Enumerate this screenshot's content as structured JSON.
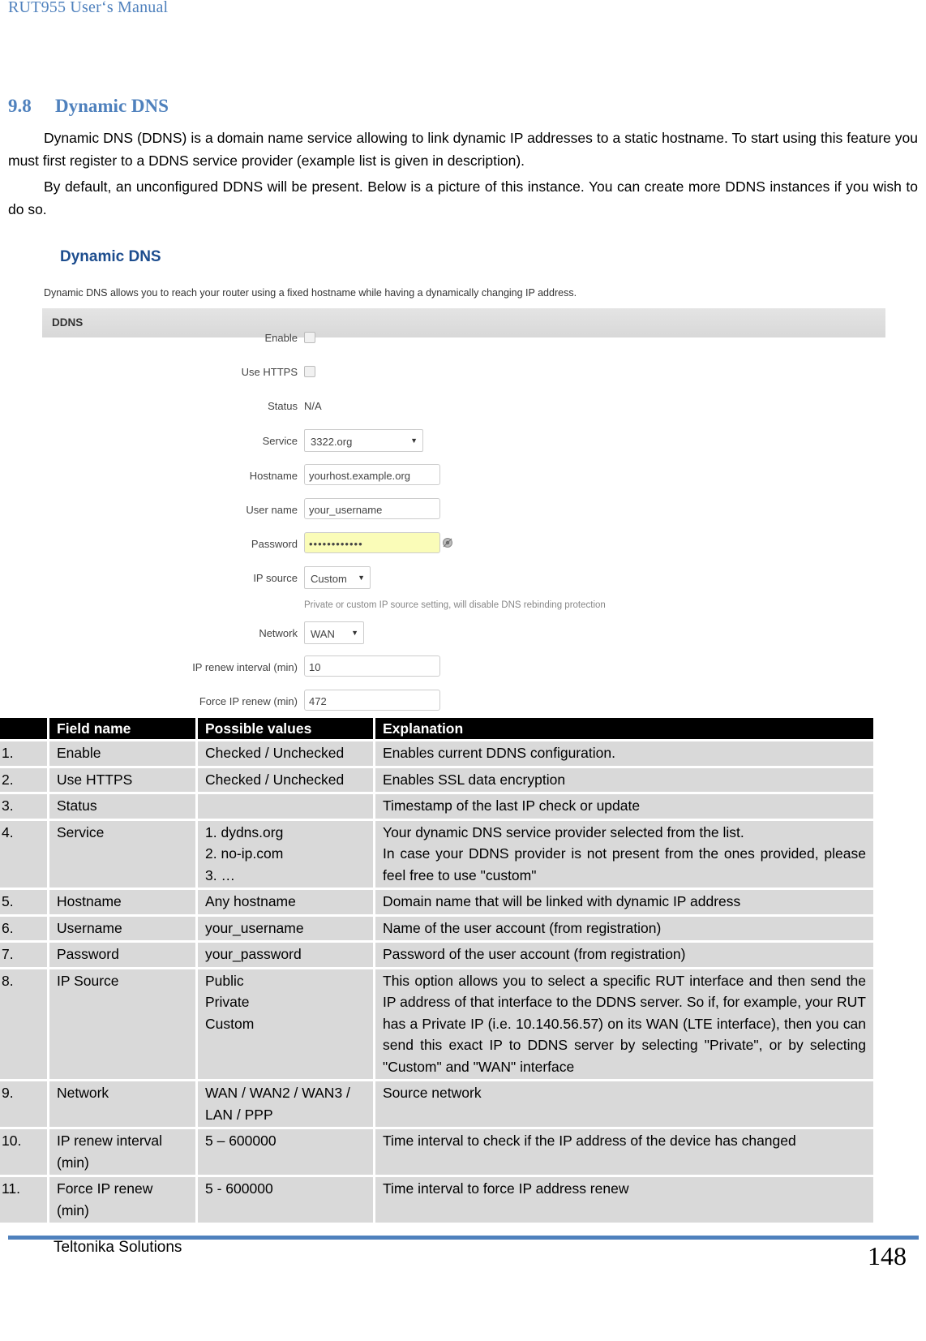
{
  "header": {
    "running_title": "RUT955 User‘s Manual"
  },
  "section": {
    "number": "9.8",
    "title": "Dynamic DNS"
  },
  "paragraphs": [
    "Dynamic DNS (DDNS) is a domain name service allowing to link dynamic IP addresses to a static hostname. To start using this feature you must first register to a DDNS service provider (example list is given in description).",
    "By default, an unconfigured DDNS will be present. Below is a picture of this instance. You can create more DDNS instances if you wish to do so."
  ],
  "screenshot": {
    "title": "Dynamic DNS",
    "description": "Dynamic DNS allows you to reach your router using a fixed hostname while having a dynamically changing IP address.",
    "section_label": "DDNS",
    "fields": {
      "enable": {
        "label": "Enable",
        "checked": false
      },
      "use_https": {
        "label": "Use HTTPS",
        "checked": false
      },
      "status": {
        "label": "Status",
        "value": "N/A"
      },
      "service": {
        "label": "Service",
        "value": "3322.org"
      },
      "hostname": {
        "label": "Hostname",
        "value": "yourhost.example.org"
      },
      "username": {
        "label": "User name",
        "value": "your_username"
      },
      "password": {
        "label": "Password",
        "value": "••••••••••••"
      },
      "ip_source": {
        "label": "IP source",
        "value": "Custom",
        "hint": "Private or custom IP source setting, will disable DNS rebinding protection"
      },
      "network": {
        "label": "Network",
        "value": "WAN"
      },
      "ip_renew_interval": {
        "label": "IP renew interval (min)",
        "value": "10"
      },
      "force_ip_renew": {
        "label": "Force IP renew (min)",
        "value": "472"
      }
    },
    "icons": {
      "caret": "▼",
      "reveal_password": "eye-icon"
    }
  },
  "table": {
    "headers": [
      "",
      "Field name",
      "Possible values",
      "Explanation"
    ],
    "rows": [
      {
        "num": "1.",
        "field": "Enable",
        "values": "Checked / Unchecked",
        "explanation": "Enables current DDNS configuration."
      },
      {
        "num": "2.",
        "field": "Use HTTPS",
        "values": "Checked / Unchecked",
        "explanation": "Enables SSL data encryption"
      },
      {
        "num": "3.",
        "field": "Status",
        "values": "",
        "explanation": "Timestamp of the last IP check or update"
      },
      {
        "num": "4.",
        "field": "Service",
        "values": "1. dydns.org\n2. no-ip.com\n3. …",
        "explanation": "Your dynamic DNS service provider selected from the list.\nIn case your DDNS provider is not present from the ones provided, please feel free to use \"custom\""
      },
      {
        "num": "5.",
        "field": "Hostname",
        "values": "Any hostname",
        "explanation": "Domain name that will be linked with dynamic IP address"
      },
      {
        "num": "6.",
        "field": "Username",
        "values": "your_username",
        "explanation": "Name of the user account (from registration)"
      },
      {
        "num": "7.",
        "field": "Password",
        "values": "your_password",
        "explanation": "Password of the user account (from registration)"
      },
      {
        "num": "8.",
        "field": "IP Source",
        "values": "Public\nPrivate\nCustom",
        "explanation": "This option allows you to select a specific RUT interface and then send the IP address of that interface to the DDNS server. So if, for example, your RUT has a Private IP (i.e. 10.140.56.57) on its WAN (LTE interface), then you can send this exact IP to DDNS server by selecting \"Private\", or by selecting \"Custom\" and \"WAN\" interface"
      },
      {
        "num": "9.",
        "field": "Network",
        "values": "WAN / WAN2 / WAN3 / LAN / PPP",
        "explanation": "Source network"
      },
      {
        "num": "10.",
        "field": "IP renew interval (min)",
        "values": "5 – 600000",
        "explanation": "Time interval to check if the IP address of the device has changed"
      },
      {
        "num": "11.",
        "field": "Force IP renew (min)",
        "values": "5 - 600000",
        "explanation": "Time interval  to force IP address renew"
      }
    ]
  },
  "footer": {
    "company": "Teltonika Solutions",
    "page_number": "148"
  },
  "colors": {
    "heading_blue": "#4f81bd",
    "screenshot_title_blue": "#1d4d8e",
    "table_header_bg": "#000000",
    "table_cell_bg": "#d9d9d9",
    "password_field_bg": "#fafcb8"
  }
}
